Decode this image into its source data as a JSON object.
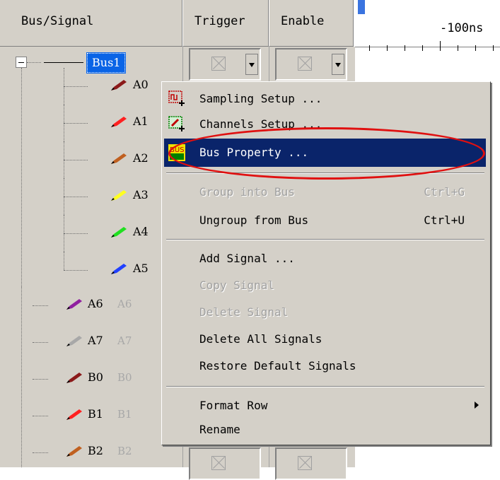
{
  "header": {
    "bus_signal": "Bus/Signal",
    "trigger": "Trigger",
    "enable": "Enable"
  },
  "ruler": {
    "label": "-100ns"
  },
  "bus": {
    "label": "Bus1"
  },
  "signals": [
    {
      "name": "A0",
      "color": "#8b1a1a"
    },
    {
      "name": "A1",
      "color": "#ff2020"
    },
    {
      "name": "A2",
      "color": "#c06020"
    },
    {
      "name": "A3",
      "color": "#ffff20"
    },
    {
      "name": "A4",
      "color": "#20e020"
    },
    {
      "name": "A5",
      "color": "#2040ff"
    }
  ],
  "ungrouped": [
    {
      "name": "A6",
      "alias": "A6",
      "color": "#9020a0"
    },
    {
      "name": "A7",
      "alias": "A7",
      "color": "#a8a8a8"
    },
    {
      "name": "B0",
      "alias": "B0",
      "color": "#8b1a1a"
    },
    {
      "name": "B1",
      "alias": "B1",
      "color": "#ff2020"
    },
    {
      "name": "B2",
      "alias": "B2",
      "color": "#c06020"
    }
  ],
  "menu": {
    "sampling_setup": "Sampling Setup ...",
    "channels_setup": "Channels Setup ...",
    "bus_property": "Bus Property ...",
    "group_into_bus": "Group into Bus",
    "group_into_bus_shortcut": "Ctrl+G",
    "ungroup_from_bus": "Ungroup from Bus",
    "ungroup_from_bus_shortcut": "Ctrl+U",
    "add_signal": "Add Signal ...",
    "copy_signal": "Copy Signal",
    "delete_signal": "Delete Signal",
    "delete_all_signals": "Delete All Signals",
    "restore_default_signals": "Restore Default Signals",
    "format_row": "Format Row",
    "rename": "Rename"
  },
  "icons": {
    "sampling": "sampling-setup-icon",
    "channels": "channels-setup-icon",
    "bus": "bus-property-icon"
  },
  "colors": {
    "menu_highlight": "#0a246a",
    "selection": "#0a64e6",
    "annotation": "#e01010"
  }
}
